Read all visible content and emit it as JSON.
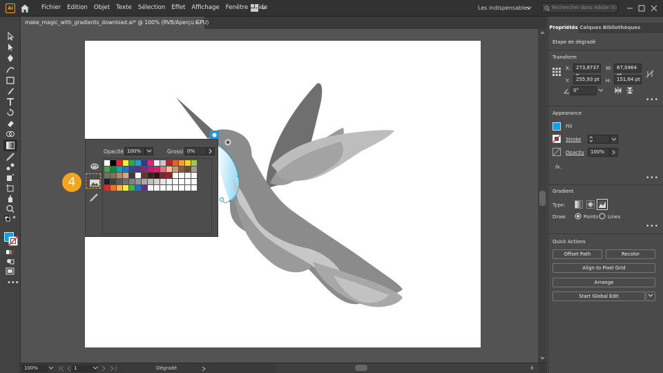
{
  "app": {
    "logo_text": "Ai",
    "menus": [
      "Fichier",
      "Edition",
      "Objet",
      "Texte",
      "Sélection",
      "Effet",
      "Affichage",
      "Fenêtre",
      "Aide"
    ],
    "workspace": "Les indispensables",
    "search_placeholder": "Rechercher dans Adobe Stock"
  },
  "document_tab": {
    "title": "make_magic_with_gradients_download.ai* @ 100% (RVB/Aperçu GPU)",
    "close": "×"
  },
  "swatch_panel": {
    "opacity_label": "Opacité :",
    "opacity_value": "100%",
    "size_label": "Grossi :",
    "size_value": "0%"
  },
  "callout": {
    "number": "4"
  },
  "status_bar": {
    "zoom": "100%",
    "artboard_number": "1",
    "tool_name": "Dégradé"
  },
  "right_panel": {
    "tabs": [
      "Propriétés",
      "Calques",
      "Bibliothèques"
    ],
    "context_label": "Etape de dégradé",
    "transform": {
      "title": "Transform",
      "x_label": "X:",
      "x_value": "273,8737 p",
      "y_label": "Y:",
      "y_value": "255,93 pt",
      "w_label": "W:",
      "w_value": "67,0464 pt",
      "h_label": "H:",
      "h_value": "151,64 pt",
      "angle_value": "0°"
    },
    "appearance": {
      "title": "Appearance",
      "fill_label": "Fill",
      "stroke_label": "Stroke",
      "opacity_label": "Opacity",
      "opacity_value": "100%",
      "fx_label": "fx."
    },
    "gradient": {
      "title": "Gradient",
      "type_label": "Type:",
      "draw_label": "Draw:",
      "points_label": "Points",
      "lines_label": "Lines"
    },
    "quick_actions": {
      "title": "Quick Actions",
      "offset_path": "Offset Path",
      "recolor": "Recolor",
      "align_pixel": "Align to Pixel Grid",
      "arrange": "Arrange",
      "global_edit": "Start Global Edit"
    },
    "more": "•••"
  },
  "colors": {
    "accent_blue": "#1e9be0",
    "callout_orange": "#f3a51c",
    "fill_swatch": "#00a2e8"
  },
  "swatches": [
    "#ffffff",
    "#000000",
    "#e8242b",
    "#f8ee33",
    "#2fa847",
    "#1a9fd8",
    "#2e3c92",
    "#e61f83",
    "#f0f0f0",
    "#c8c8c8",
    "#c02027",
    "#e66125",
    "#f4a123",
    "#f7d51f",
    "#a3cb3a",
    "#4ca046",
    "#0f8a43",
    "#15a3a1",
    "#2078bd",
    "#304697",
    "#5b2e87",
    "#7b2c83",
    "#b42476",
    "#e21f6a",
    "#e96c86",
    "#f2c29c",
    "#c69c72",
    "#8d5c36",
    "#6d4a2c",
    "#a89c8e",
    "#707070",
    "#8a6e58",
    "#b2896a",
    "#d2a883",
    "#3c3c3c",
    "#ffffff",
    "#5a3b26",
    "#3b1f12",
    "#2a1810",
    "#6b2c2c",
    "#a01d26",
    "#ffffff",
    "#ffffff",
    "#ffffff",
    "#ffffff",
    "#202020",
    "#404040",
    "#5a5a5a",
    "#6e6e6e",
    "#828282",
    "#969696",
    "#aaaaaa",
    "#bebebe",
    "#d2d2d2",
    "#e6e6e6",
    "#f5f5f5",
    "#ffffff",
    "#ffffff",
    "#ffffff",
    "#ffffff",
    "#e8242b",
    "#f36f21",
    "#fbb03b",
    "#f7ee3a",
    "#39b54a",
    "#1b75bc",
    "#662d91",
    "#ffffff",
    "#ffffff",
    "#ffffff",
    "#ffffff",
    "#ffffff",
    "#ffffff",
    "#ffffff",
    "#ffffff"
  ]
}
